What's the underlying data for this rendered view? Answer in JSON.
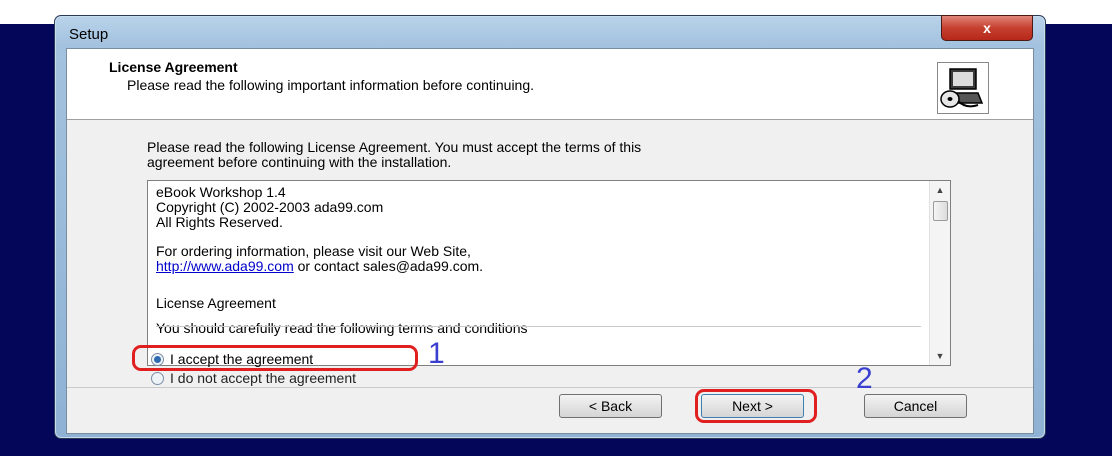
{
  "window": {
    "title": "Setup",
    "close_glyph": "x"
  },
  "header": {
    "title": "License Agreement",
    "subtitle": "Please read the following important information before continuing.",
    "icon": "computer-disk-install-icon"
  },
  "intro": {
    "line1": "Please read the following License Agreement. You must accept the terms of this",
    "line2": "agreement before continuing with the installation."
  },
  "license": {
    "line1": "eBook Workshop 1.4",
    "line2": "Copyright (C) 2002-2003 ada99.com",
    "line3": "All Rights Reserved.",
    "line4": "For ordering information, please visit our Web Site,",
    "link": "http://www.ada99.com",
    "line5_rest": " or contact sales@ada99.com.",
    "line6": "License Agreement",
    "line7": "You should carefully read the following terms and conditions"
  },
  "options": {
    "accept_label": "I accept the agreement",
    "reject_label": "I do not accept the agreement",
    "selected": "accept"
  },
  "annotations": {
    "step1": "1",
    "step2": "2",
    "highlight_color": "#e02020",
    "number_color": "#3a3fd0"
  },
  "buttons": {
    "back_label": "< Back",
    "next_label": "Next >",
    "cancel_label": "Cancel"
  }
}
